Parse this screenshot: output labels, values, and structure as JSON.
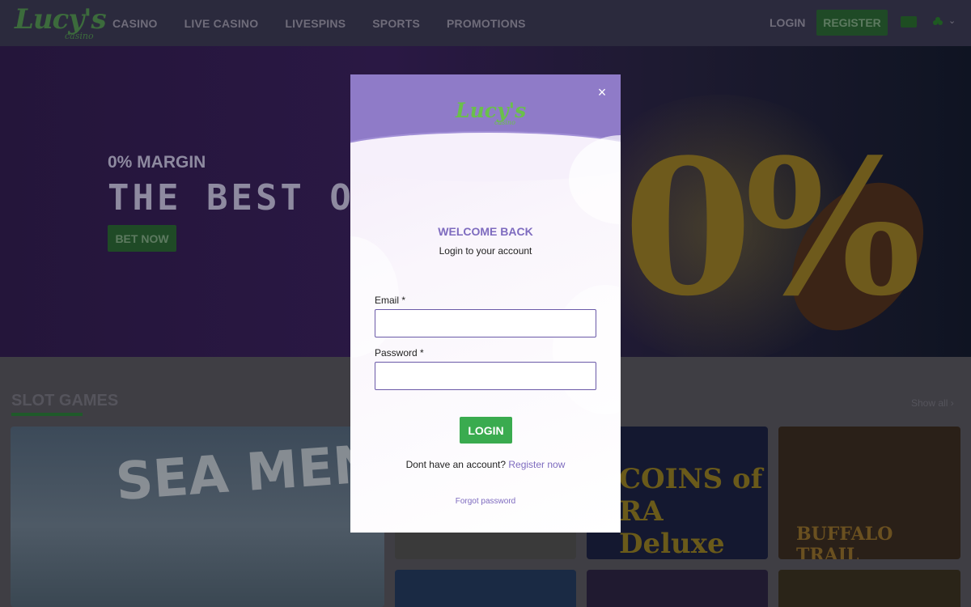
{
  "header": {
    "logo_main": "Lucy's",
    "logo_sub": "casino",
    "nav": [
      {
        "label": "CASINO"
      },
      {
        "label": "LIVE CASINO"
      },
      {
        "label": "LIVESPINS"
      },
      {
        "label": "SPORTS"
      },
      {
        "label": "PROMOTIONS"
      }
    ],
    "login_label": "LOGIN",
    "register_label": "REGISTER",
    "flag_icon": "flag-icon",
    "language_icon": "clover-icon",
    "chevron": "⌄"
  },
  "hero": {
    "subtitle": "0% MARGIN",
    "title": "THE BEST ODDS",
    "button_label": "BET NOW",
    "graphic_text": "0%"
  },
  "slots": {
    "title": "SLOT GAMES",
    "show_all": "Show all ›",
    "games": [
      {
        "name": "SEA MEN"
      },
      {
        "name": "COINS of RA Deluxe"
      },
      {
        "name": "BUFFALO TRAIL"
      }
    ]
  },
  "modal": {
    "logo_main": "Lucy's",
    "logo_sub": "casino",
    "close_icon": "×",
    "heading": "WELCOME BACK",
    "subheading": "Login to your account",
    "email_label": "Email *",
    "email_value": "",
    "password_label": "Password *",
    "password_value": "",
    "login_button": "LOGIN",
    "no_account_text": "Dont have an account?",
    "register_link": "Register now",
    "forgot_password": "Forgot password"
  },
  "colors": {
    "accent_purple": "#7e6bbf",
    "modal_header": "#8f7bc8",
    "login_green": "#3aab4f",
    "overlay_green": "#1f4a26"
  }
}
